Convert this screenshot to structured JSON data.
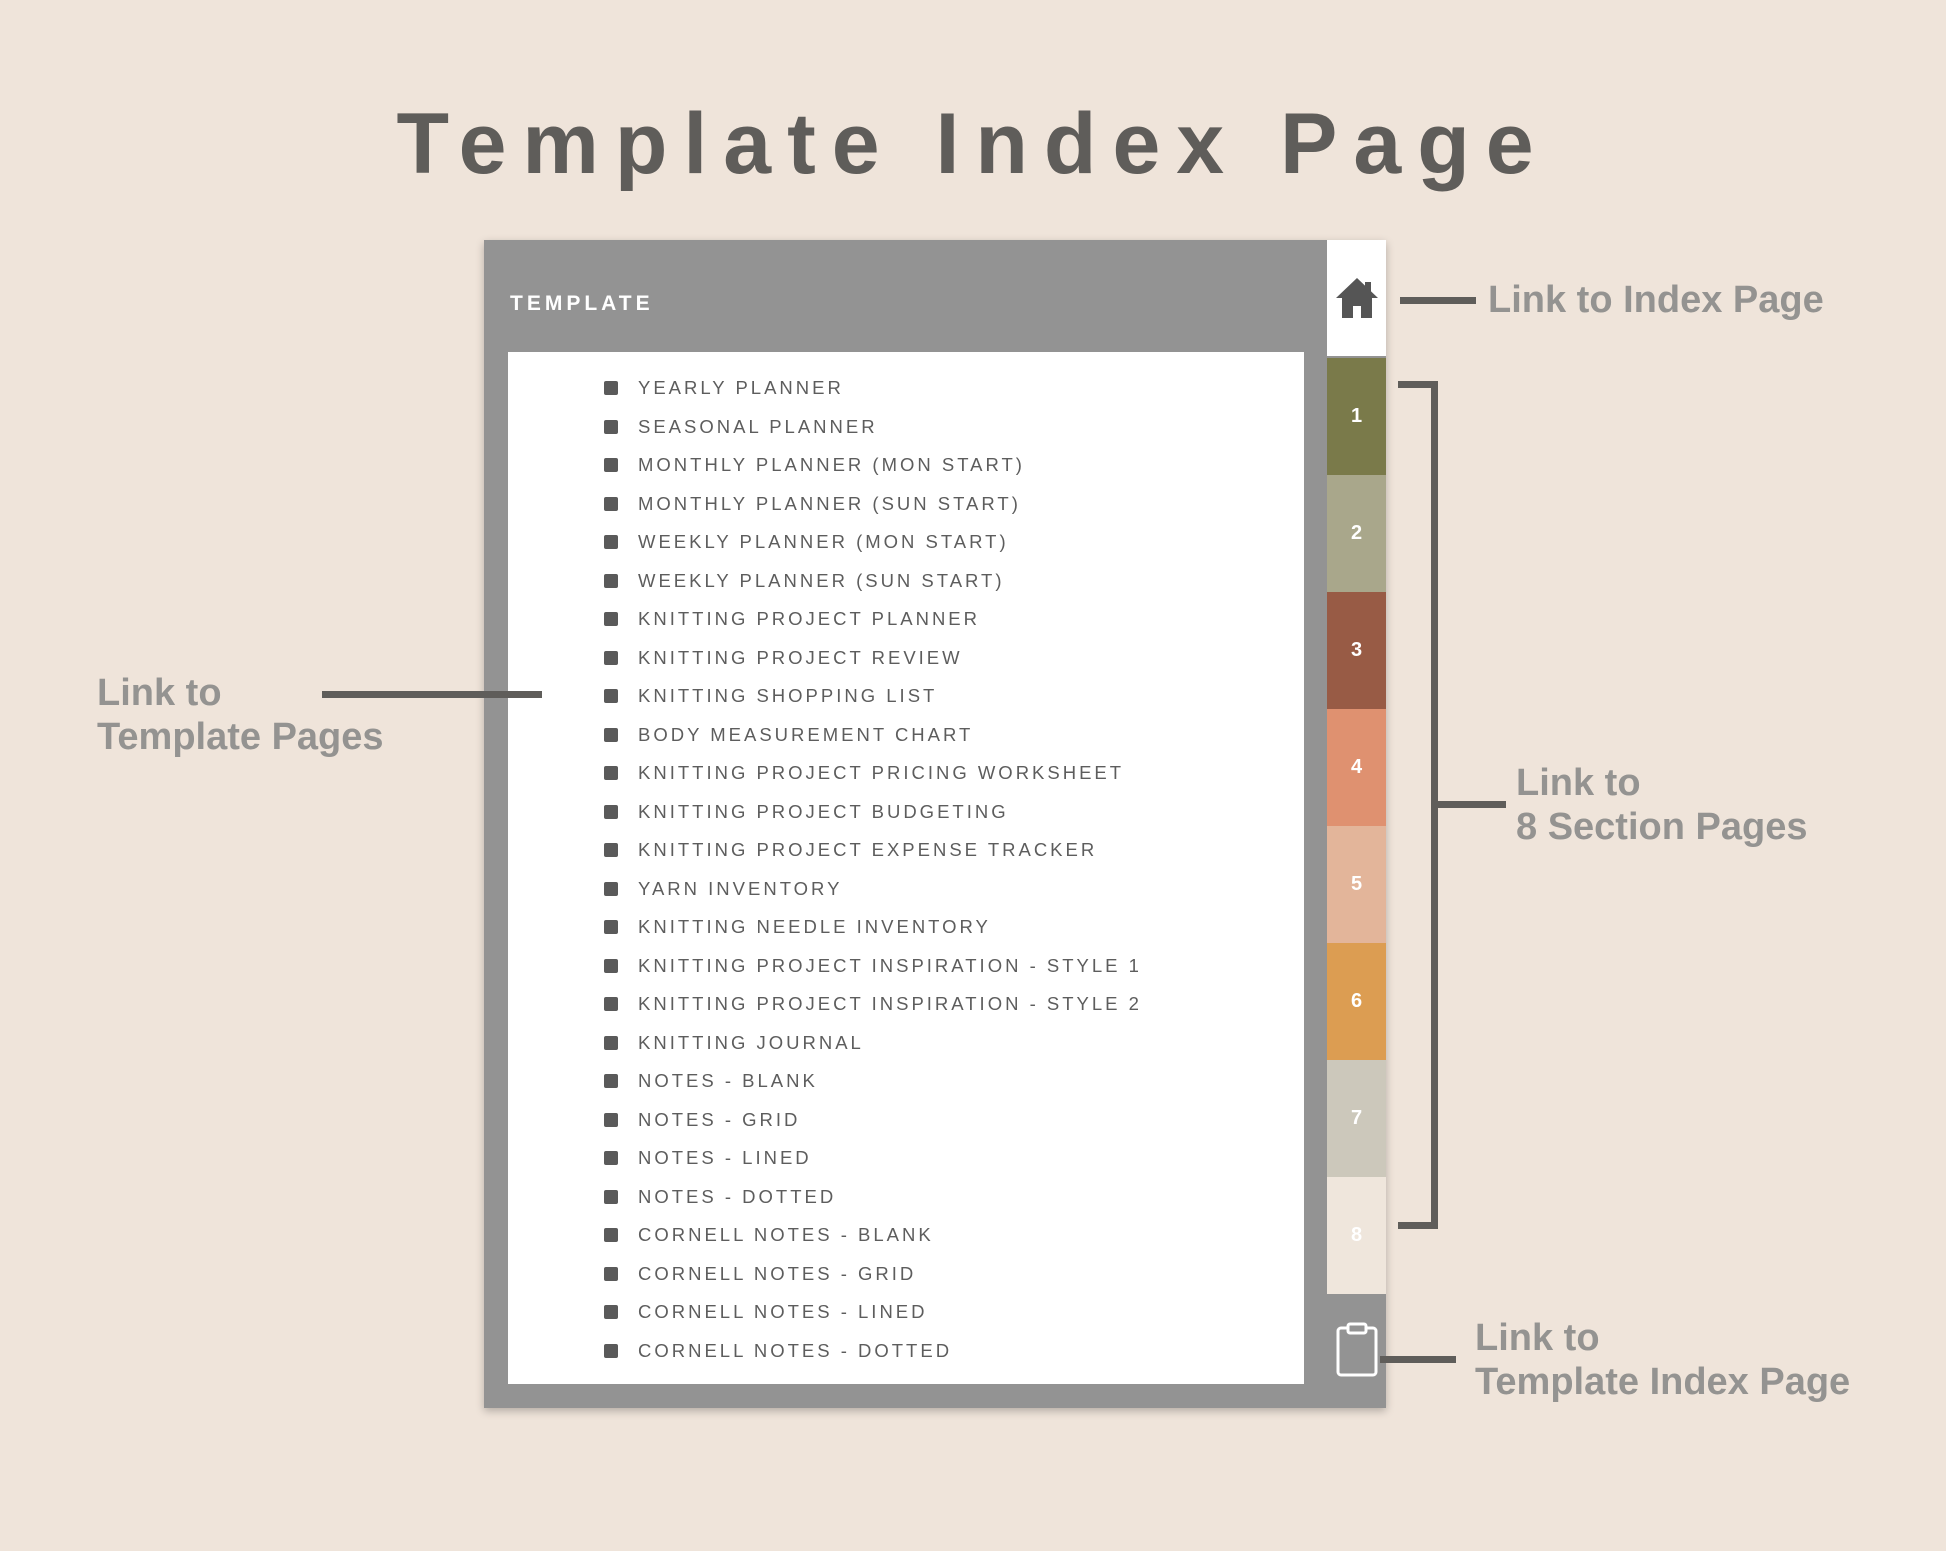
{
  "page": {
    "title": "Template Index Page"
  },
  "planner": {
    "header_label": "TEMPLATE",
    "templates": [
      "YEARLY PLANNER",
      "SEASONAL PLANNER",
      "MONTHLY PLANNER (MON START)",
      "MONTHLY PLANNER (SUN START)",
      "WEEKLY PLANNER (MON START)",
      "WEEKLY PLANNER (SUN START)",
      "KNITTING PROJECT PLANNER",
      "KNITTING PROJECT REVIEW",
      "KNITTING SHOPPING LIST",
      "BODY MEASUREMENT CHART",
      "KNITTING PROJECT PRICING WORKSHEET",
      "KNITTING PROJECT BUDGETING",
      "KNITTING PROJECT EXPENSE TRACKER",
      "YARN INVENTORY",
      "KNITTING NEEDLE INVENTORY",
      "KNITTING PROJECT INSPIRATION - STYLE 1",
      "KNITTING PROJECT INSPIRATION - STYLE 2",
      "KNITTING JOURNAL",
      "NOTES - BLANK",
      "NOTES - GRID",
      "NOTES - LINED",
      "NOTES - DOTTED",
      "CORNELL NOTES - BLANK",
      "CORNELL NOTES - GRID",
      "CORNELL NOTES - LINED",
      "CORNELL NOTES - DOTTED"
    ]
  },
  "tabs": {
    "home_icon": "home-icon",
    "clipboard_icon": "clipboard-icon",
    "sections": [
      {
        "label": "1",
        "color": "#7a7a4a"
      },
      {
        "label": "2",
        "color": "#a9a78b"
      },
      {
        "label": "3",
        "color": "#985b45"
      },
      {
        "label": "4",
        "color": "#df9170"
      },
      {
        "label": "5",
        "color": "#e3b59a"
      },
      {
        "label": "6",
        "color": "#dc9d52"
      },
      {
        "label": "7",
        "color": "#ccc8bb"
      },
      {
        "label": "8",
        "color": "#efe6dc"
      }
    ]
  },
  "annotations": {
    "index_page": "Link to Index Page",
    "template_pages": [
      "Link to",
      "Template Pages"
    ],
    "section_pages": [
      "Link to",
      "8 Section Pages"
    ],
    "template_index_page": [
      "Link to",
      "Template Index Page"
    ]
  }
}
